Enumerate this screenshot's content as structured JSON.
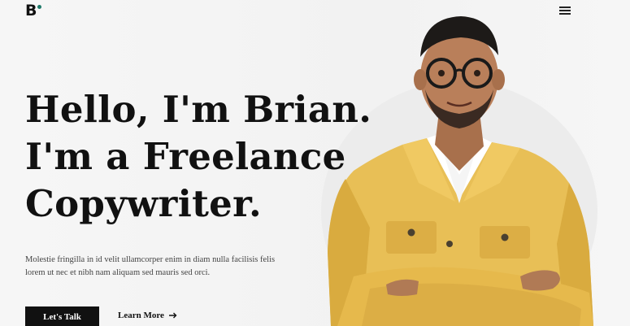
{
  "header": {
    "logo_text": "B",
    "logo_dot_color": "#1f7a6a",
    "menu_icon": "hamburger-menu-icon"
  },
  "hero": {
    "headline": {
      "line1": "Hello, I'm Brian.",
      "line2": "I'm a Freelance",
      "line3": "Copywriter."
    },
    "description": "Molestie fringilla in id velit ullamcorper enim in diam nulla facilisis felis lorem ut nec et nibh nam aliquam sed mauris sed orci.",
    "primary_button": "Let's Talk",
    "secondary_link": "Learn More",
    "secondary_link_icon": "arrow-right-icon"
  },
  "colors": {
    "background": "#f4f4f4",
    "text": "#111111",
    "accent": "#1f7a6a",
    "jacket": "#e8bf56"
  }
}
